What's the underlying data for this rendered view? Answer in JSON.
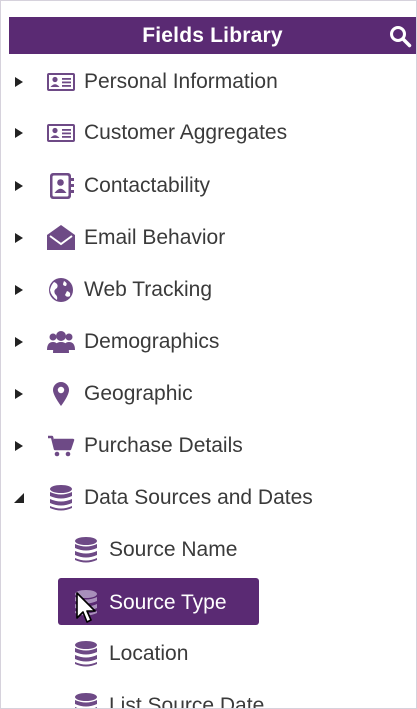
{
  "header": {
    "title": "Fields Library",
    "search_icon": "search-icon"
  },
  "colors": {
    "accent": "#5a2a73",
    "icon": "#6e4a86",
    "text": "#3a3a3a"
  },
  "items": [
    {
      "label": "Personal Information",
      "icon": "id-card-icon",
      "expanded": false
    },
    {
      "label": "Customer Aggregates",
      "icon": "id-card-icon",
      "expanded": false
    },
    {
      "label": "Contactability",
      "icon": "contact-book-icon",
      "expanded": false
    },
    {
      "label": "Email Behavior",
      "icon": "envelope-open-icon",
      "expanded": false
    },
    {
      "label": "Web Tracking",
      "icon": "globe-icon",
      "expanded": false
    },
    {
      "label": "Demographics",
      "icon": "users-icon",
      "expanded": false
    },
    {
      "label": "Geographic",
      "icon": "map-pin-icon",
      "expanded": false
    },
    {
      "label": "Purchase Details",
      "icon": "shopping-cart-icon",
      "expanded": false
    },
    {
      "label": "Data Sources and Dates",
      "icon": "database-icon",
      "expanded": true
    }
  ],
  "subitems": [
    {
      "label": "Source Name",
      "icon": "database-icon",
      "selected": false
    },
    {
      "label": "Source Type",
      "icon": "database-icon",
      "selected": true
    },
    {
      "label": "Location",
      "icon": "database-icon",
      "selected": false
    },
    {
      "label": "List Source Date",
      "icon": "database-icon",
      "selected": false
    }
  ]
}
